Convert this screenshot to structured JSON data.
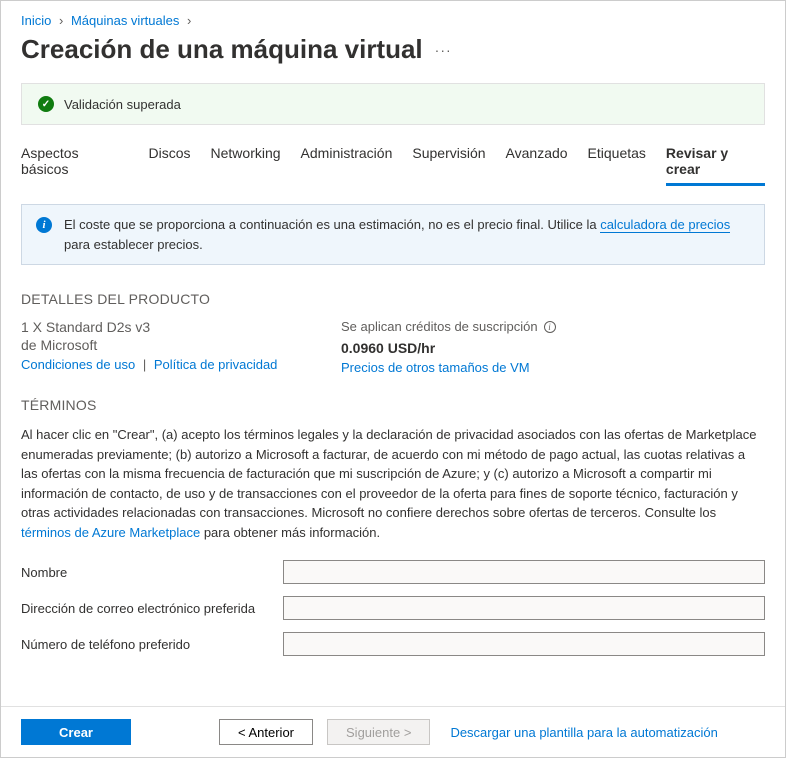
{
  "breadcrumb": {
    "home": "Inicio",
    "vms": "Máquinas virtuales"
  },
  "page_title": "Creación de una máquina virtual",
  "validation": {
    "message": "Validación superada"
  },
  "tabs": [
    {
      "label": "Aspectos básicos"
    },
    {
      "label": "Discos"
    },
    {
      "label": "Networking"
    },
    {
      "label": "Administración"
    },
    {
      "label": "Supervisión"
    },
    {
      "label": "Avanzado"
    },
    {
      "label": "Etiquetas"
    },
    {
      "label": "Revisar y crear"
    }
  ],
  "info_banner": {
    "text_prefix": "El coste que se proporciona a continuación es una estimación, no es el precio final. Utilice la ",
    "link": "calculadora de precios",
    "text_suffix": " para establecer precios."
  },
  "sections": {
    "product_heading": "DETALLES DEL PRODUCTO",
    "terms_heading": "TÉRMINOS"
  },
  "product": {
    "sku": "1 X Standard D2s v3",
    "vendor": "de Microsoft",
    "terms_link": "Condiciones de uso",
    "privacy_link": "Política de privacidad",
    "credits_label": "Se aplican créditos de suscripción",
    "price": "0.0960 USD/hr",
    "other_sizes_link": "Precios de otros tamaños de VM"
  },
  "terms": {
    "body": "Al hacer clic en \"Crear\", (a) acepto los términos legales y la declaración de privacidad asociados con las ofertas de Marketplace enumeradas previamente; (b) autorizo a Microsoft a facturar, de acuerdo con mi método de pago actual, las cuotas relativas a las ofertas con la misma frecuencia de facturación que mi suscripción de Azure; y (c) autorizo a Microsoft a compartir mi información de contacto, de uso y de transacciones con el proveedor de la oferta para fines de soporte técnico, facturación y otras actividades relacionadas con transacciones. Microsoft no confiere derechos sobre ofertas de terceros. Consulte los ",
    "link": "términos de Azure Marketplace",
    "suffix": " para obtener más información."
  },
  "form": {
    "name_label": "Nombre",
    "email_label": "Dirección de correo electrónico preferida",
    "phone_label": "Número de teléfono preferido",
    "name_value": "",
    "email_value": "",
    "phone_value": ""
  },
  "footer": {
    "create": "Crear",
    "previous": "< Anterior",
    "next": "Siguiente >",
    "download_template": "Descargar una plantilla para la automatización"
  }
}
